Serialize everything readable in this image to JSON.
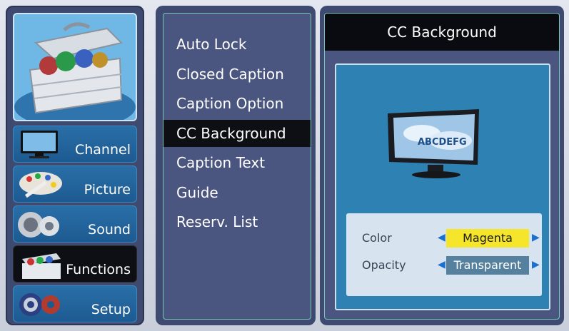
{
  "sidebar": {
    "items": [
      {
        "label": "Channel",
        "icon": "tv-icon"
      },
      {
        "label": "Picture",
        "icon": "palette-icon"
      },
      {
        "label": "Sound",
        "icon": "speaker-icon"
      },
      {
        "label": "Functions",
        "icon": "toolbox-icon"
      },
      {
        "label": "Setup",
        "icon": "gears-icon"
      }
    ],
    "active": "Functions"
  },
  "function_menu": {
    "items": [
      "Auto Lock",
      "Closed Caption",
      "Caption Option",
      "CC Background",
      "Caption Text",
      "Guide",
      "Reserv. List"
    ],
    "selected": "CC Background"
  },
  "detail": {
    "title": "CC Background",
    "preview_text": "ABCDEFG",
    "settings": [
      {
        "label": "Color",
        "value": "Magenta",
        "highlighted": true
      },
      {
        "label": "Opacity",
        "value": "Transparent",
        "highlighted": false
      }
    ]
  },
  "colors": {
    "highlight": "#f5e62b",
    "panel": "#3f4a70",
    "selection": "#0d0f14",
    "accent_border": "#79c7b9"
  }
}
